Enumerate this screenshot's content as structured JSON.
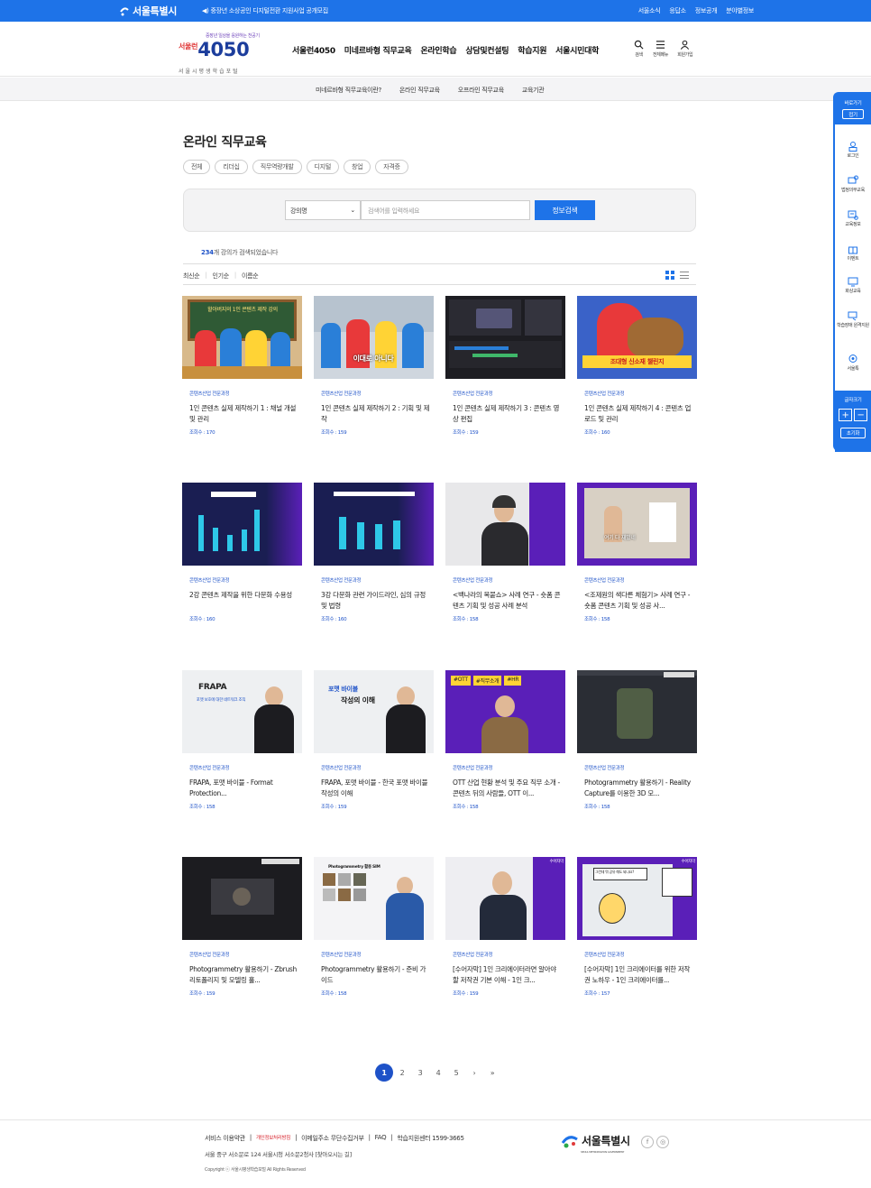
{
  "topbar": {
    "city": "서울특별시",
    "notice": "◀) 중장년 소상공인 디지털전환 지원사업 공개모집",
    "links": [
      "서울소식",
      "응답소",
      "정보공개",
      "분야별정보"
    ]
  },
  "brand": {
    "tagline": "중장년 일상을 응원하는 천공기",
    "logo_prefix": "서울런",
    "logo_main": "4050",
    "subtitle": "서울시평생학습포털"
  },
  "gnb": [
    "서울런4050",
    "미네르바형 직무교육",
    "온라인학습",
    "상담및컨설팅",
    "학습지원",
    "서울시민대학"
  ],
  "util": [
    {
      "label": "검색",
      "icon": "search-icon"
    },
    {
      "label": "전체메뉴",
      "icon": "menu-icon"
    },
    {
      "label": "회원가입",
      "icon": "user-icon"
    }
  ],
  "subnav": [
    "미네르바형 직무교육이란?",
    "온라인 직무교육",
    "오프라인 직무교육",
    "교육기관"
  ],
  "page": {
    "title": "온라인 직무교육"
  },
  "categories": [
    "전체",
    "리더십",
    "직무역량개발",
    "디지털",
    "창업",
    "자격증"
  ],
  "search": {
    "select_value": "강의명",
    "placeholder": "검색어를 입력하세요",
    "button": "정보검색"
  },
  "result": {
    "count": "234",
    "text": "개 강의가 검색되었습니다"
  },
  "sort": [
    "최신순",
    "인기순",
    "이름순"
  ],
  "courses": [
    {
      "category": "콘텐츠산업 전문과정",
      "title": "1인 콘텐츠 실제 제작하기 1 : 채널 개설 및 관리",
      "views": "조회수 : 170",
      "theme": "classroom"
    },
    {
      "category": "콘텐츠산업 전문과정",
      "title": "1인 콘텐츠 실제 제작하기 2 : 기획 및 제작",
      "views": "조회수 : 159",
      "theme": "street"
    },
    {
      "category": "콘텐츠산업 전문과정",
      "title": "1인 콘텐츠 실제 제작하기 3 : 콘텐츠 영상 편집",
      "views": "조회수 : 159",
      "theme": "editor"
    },
    {
      "category": "콘텐츠산업 전문과정",
      "title": "1인 콘텐츠 실제 제작하기 4 : 콘텐츠 업로드 및 관리",
      "views": "조회수 : 160",
      "theme": "food"
    },
    {
      "category": "콘텐츠산업 전문과정",
      "title": "2강 콘텐츠 제작을 위한 다문화 수용성",
      "views": "조회수 : 160",
      "theme": "chart1"
    },
    {
      "category": "콘텐츠산업 전문과정",
      "title": "3강 다문화 관련 가이드라인, 심의 규정 및 법령",
      "views": "조회수 : 160",
      "theme": "chart2"
    },
    {
      "category": "콘텐츠산업 전문과정",
      "title": "<백나라의 복붙쇼> 사례 연구 - 숏폼 콘텐츠 기획 및 성공 사례 분석",
      "views": "조회수 : 158",
      "theme": "lecturer"
    },
    {
      "category": "콘텐츠산업 전문과정",
      "title": "<조제원의 색다른 체험기> 사례 연구 - 숏폼 콘텐츠 기획 및 성공 사...",
      "views": "조회수 : 158",
      "theme": "frame"
    },
    {
      "category": "콘텐츠산업 전문과정",
      "title": "FRAPA, 포맷 바이블 - Format Protection...",
      "views": "조회수 : 158",
      "theme": "frapa"
    },
    {
      "category": "콘텐츠산업 전문과정",
      "title": "FRAPA, 포맷 바이블 - 한국 포맷 바이블 작성의 이해",
      "views": "조회수 : 159",
      "theme": "bible"
    },
    {
      "category": "콘텐츠산업 전문과정",
      "title": "OTT 산업 현황 분석 및 주요 직무 소개 - 콘텐츠 뒤의 사람들, OTT 이...",
      "views": "조회수 : 158",
      "theme": "ott"
    },
    {
      "category": "콘텐츠산업 전문과정",
      "title": "Photogrammetry 활용하기 - Reality Capture를 이용한 3D 모...",
      "views": "조회수 : 158",
      "theme": "dark3d"
    },
    {
      "category": "콘텐츠산업 전문과정",
      "title": "Photogrammetry 활용하기 - Zbrush 리토폴리지 및 모델링 홀...",
      "views": "조회수 : 159",
      "theme": "zbrush"
    },
    {
      "category": "콘텐츠산업 전문과정",
      "title": "Photogrammetry 활용하기 - 준비 가이드",
      "views": "조회수 : 158",
      "theme": "photogram"
    },
    {
      "category": "콘텐츠산업 전문과정",
      "title": "[수어자막] 1인 크리에이터라면 알아야 할 저작권 기본 이해 - 1인 크...",
      "views": "조회수 : 159",
      "theme": "purple"
    },
    {
      "category": "콘텐츠산업 전문과정",
      "title": "[수어자막] 1인 크리에이터를 위한 저작권 노하우 - 1인 크리에이터를...",
      "views": "조회수 : 157",
      "theme": "cartoon"
    }
  ],
  "thumb_text": {
    "classroom": "할아버지의 1인 콘텐츠 제작 강의",
    "street": "이대로 아니다",
    "food": "조대형 신소재 챌린지",
    "frame": "여기 다 재밌네",
    "frapa": "FRAPA",
    "frapa_sub": "포맷 보호에 대한 네트워크 조직",
    "bible_tag": "포맷 바이블",
    "bible_main": "작성의 이해",
    "ott_tags": [
      "#OTT",
      "#직무소개",
      "#HR"
    ],
    "photogram": "Photogrammetry 활용 SIM",
    "sign": "수어자막",
    "cartoon": "그런데 뭐 공유 해도 되나요?"
  },
  "pager": {
    "pages": [
      "1",
      "2",
      "3",
      "4",
      "5"
    ],
    "current": "1",
    "next": "›",
    "last": "»"
  },
  "footer": {
    "links": [
      "서비스 이용약관",
      "개인정보처리방침",
      "이메일주소 무단수집거부",
      "FAQ",
      "학습지원센터 1599-3665"
    ],
    "address": "서울 중구 서소문로 124 서울시청 서소문2청사 [찾아오시는 길]",
    "copyright": "Copyright ⓒ 서울시평생학습포털 All Rights Reserved",
    "logo": "서울특별시",
    "logo_en": "SEOUL METROPOLITAN GOVERNMENT",
    "social": [
      "f",
      "◎"
    ]
  },
  "sidebar": {
    "head": "바로가기",
    "fold": "접기",
    "items": [
      {
        "label": "로그인",
        "icon": "login-icon"
      },
      {
        "label": "법정의무교육",
        "icon": "legal-edu-icon"
      },
      {
        "label": "교육정보",
        "icon": "edu-info-icon"
      },
      {
        "label": "이벤트",
        "icon": "event-icon"
      },
      {
        "label": "화상교육",
        "icon": "video-edu-icon"
      },
      {
        "label": "학습장애 원격지원",
        "icon": "remote-support-icon"
      },
      {
        "label": "서울톡",
        "icon": "seoul-talk-icon"
      }
    ],
    "font_size": "글자크기",
    "plus": "+",
    "minus": "−",
    "reset": "초기화"
  },
  "colors": {
    "primary": "#1e73e8",
    "accent": "#1e52c8",
    "purple": "#5a1fb8"
  }
}
